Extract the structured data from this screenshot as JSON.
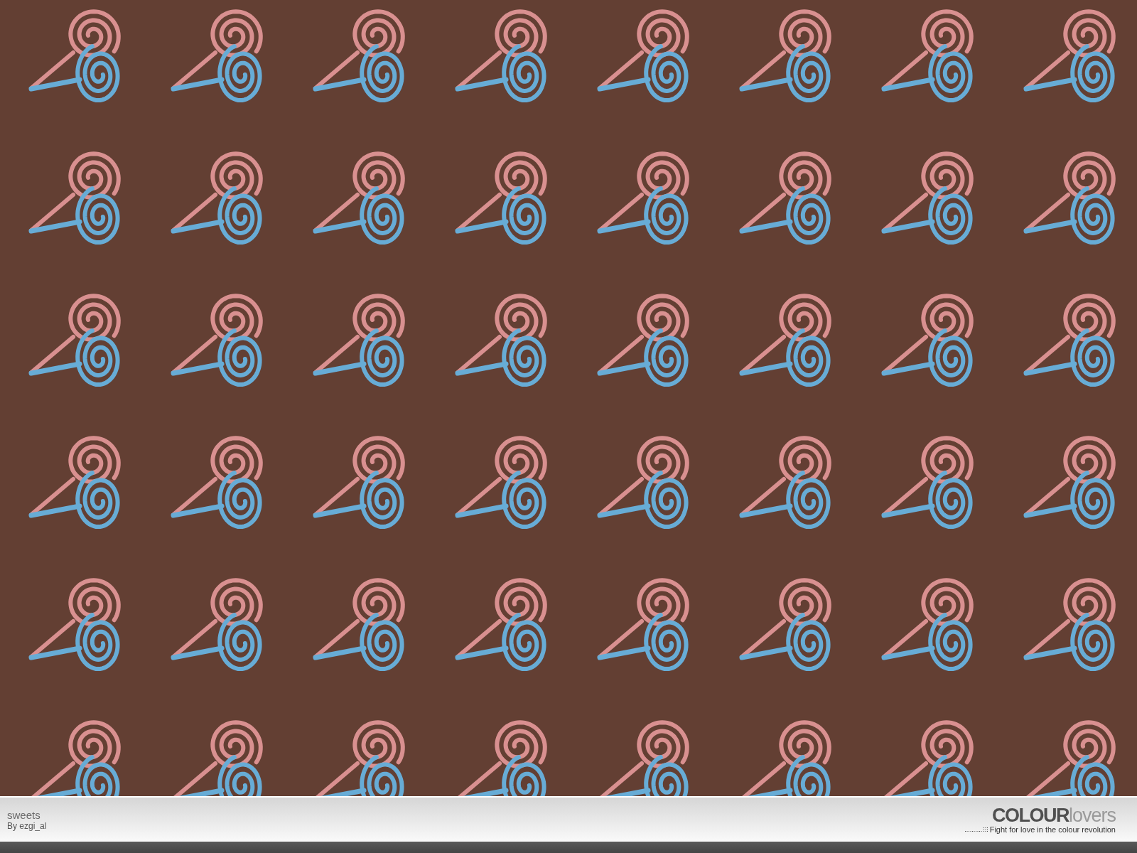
{
  "pattern": {
    "title": "sweets",
    "author": "By ezgi_al"
  },
  "brand": {
    "logo_bold": "COLOUR",
    "logo_light": "lovers",
    "tagline": "Fight for love in the colour revolution"
  }
}
